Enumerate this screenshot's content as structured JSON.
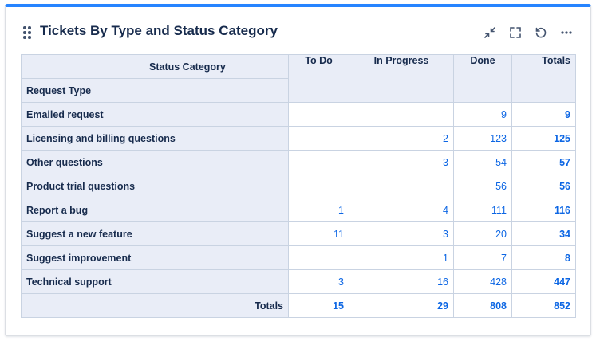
{
  "gadget": {
    "title": "Tickets By Type and Status Category",
    "icons": [
      "drag-handle-icon",
      "minimize-icon",
      "fullscreen-icon",
      "refresh-icon",
      "more-icon"
    ]
  },
  "table": {
    "column_header_label": "Status Category",
    "row_header_label": "Request Type",
    "columns": [
      "To Do",
      "In Progress",
      "Done",
      "Totals"
    ],
    "rows": [
      {
        "label": "Emailed request",
        "todo": "",
        "inprogress": "",
        "done": "9",
        "total": "9"
      },
      {
        "label": "Licensing and billing questions",
        "todo": "",
        "inprogress": "2",
        "done": "123",
        "total": "125"
      },
      {
        "label": "Other questions",
        "todo": "",
        "inprogress": "3",
        "done": "54",
        "total": "57"
      },
      {
        "label": "Product trial questions",
        "todo": "",
        "inprogress": "",
        "done": "56",
        "total": "56"
      },
      {
        "label": "Report a bug",
        "todo": "1",
        "inprogress": "4",
        "done": "111",
        "total": "116"
      },
      {
        "label": "Suggest a new feature",
        "todo": "11",
        "inprogress": "3",
        "done": "20",
        "total": "34"
      },
      {
        "label": "Suggest improvement",
        "todo": "",
        "inprogress": "1",
        "done": "7",
        "total": "8"
      },
      {
        "label": "Technical support",
        "todo": "3",
        "inprogress": "16",
        "done": "428",
        "total": "447"
      }
    ],
    "totals": {
      "label": "Totals",
      "todo": "15",
      "inprogress": "29",
      "done": "808",
      "total": "852"
    }
  },
  "colors": {
    "accent": "#2684ff",
    "link": "#0c66e4",
    "header_bg": "#e9edf7",
    "border": "#c9d3e2"
  }
}
